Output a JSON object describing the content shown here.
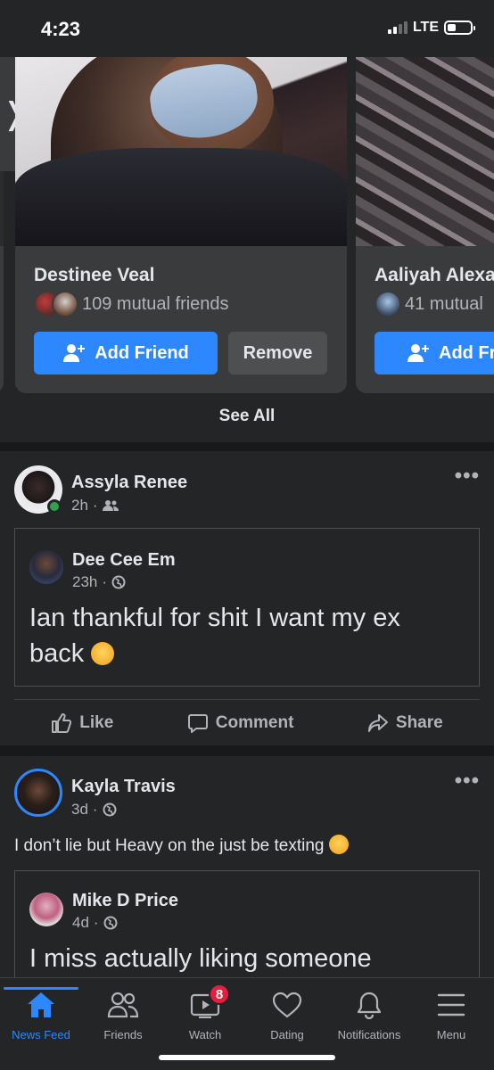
{
  "status_bar": {
    "time": "4:23",
    "network": "LTE"
  },
  "people_you_may_know": {
    "cards": [
      {
        "name": "Destinee Veal",
        "mutual": "109 mutual friends",
        "add_label": "Add Friend",
        "remove_label": "Remove"
      },
      {
        "name": "Aaliyah Alexa",
        "mutual": "41 mutual",
        "add_label": "Add Fri"
      }
    ],
    "see_all": "See All"
  },
  "posts": [
    {
      "author": "Assyla Renee",
      "time": "2h",
      "audience_icon": "friends-icon",
      "shared": {
        "author": "Dee Cee Em",
        "time": "23h",
        "audience_icon": "globe-icon",
        "text": "Ian thankful for shit I want my ex back"
      },
      "actions": {
        "like": "Like",
        "comment": "Comment",
        "share": "Share"
      }
    },
    {
      "author": "Kayla Travis",
      "time": "3d",
      "audience_icon": "globe-icon",
      "text": "I don’t lie but Heavy on the just be texting",
      "shared": {
        "author": "Mike D Price",
        "time": "4d",
        "audience_icon": "globe-icon",
        "text": "I miss actually liking someone"
      }
    }
  ],
  "tab_bar": {
    "tabs": [
      {
        "label": "News Feed",
        "icon": "home-icon",
        "active": true
      },
      {
        "label": "Friends",
        "icon": "friends-icon"
      },
      {
        "label": "Watch",
        "icon": "watch-icon",
        "badge": "8"
      },
      {
        "label": "Dating",
        "icon": "heart-icon"
      },
      {
        "label": "Notifications",
        "icon": "bell-icon"
      },
      {
        "label": "Menu",
        "icon": "menu-icon"
      }
    ]
  },
  "colors": {
    "accent": "#2d88ff",
    "background": "#18191a",
    "surface": "#242526",
    "badge": "#e41e3f"
  }
}
